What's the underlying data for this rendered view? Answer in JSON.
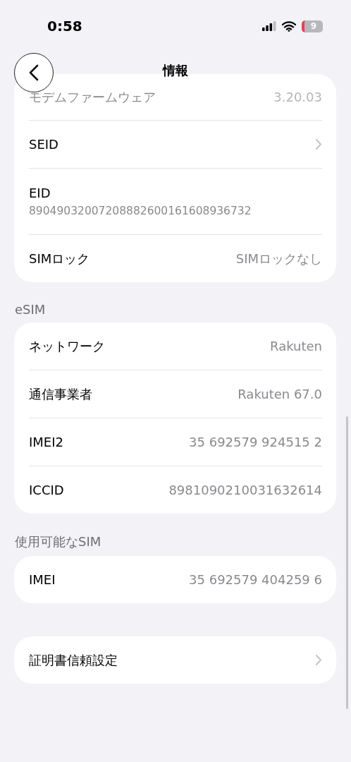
{
  "status_bar": {
    "time": "0:58",
    "battery": "9"
  },
  "nav": {
    "title": "情報"
  },
  "sections": [
    {
      "rows": [
        {
          "kind": "value",
          "label": "モデムファームウェア",
          "value": "3.20.03",
          "faded": true
        },
        {
          "kind": "link",
          "label": "SEID",
          "faded": false
        },
        {
          "kind": "stacked",
          "label": "EID",
          "value": "89049032007208882600161608936732",
          "faded": false
        },
        {
          "kind": "value",
          "label": "SIMロック",
          "value": "SIMロックなし",
          "faded": false
        }
      ]
    },
    {
      "header": "eSIM",
      "rows": [
        {
          "kind": "value",
          "label": "ネットワーク",
          "value": "Rakuten",
          "faded": false
        },
        {
          "kind": "value",
          "label": "通信事業者",
          "value": "Rakuten 67.0",
          "faded": false
        },
        {
          "kind": "value",
          "label": "IMEI2",
          "value": "35 692579 924515 2",
          "faded": false
        },
        {
          "kind": "value",
          "label": "ICCID",
          "value": "8981090210031632614",
          "faded": false
        }
      ]
    },
    {
      "header": "使用可能なSIM",
      "rows": [
        {
          "kind": "value",
          "label": "IMEI",
          "value": "35 692579 404259 6",
          "faded": false
        }
      ]
    },
    {
      "rows": [
        {
          "kind": "link",
          "label": "証明書信頼設定",
          "faded": false
        }
      ]
    }
  ]
}
